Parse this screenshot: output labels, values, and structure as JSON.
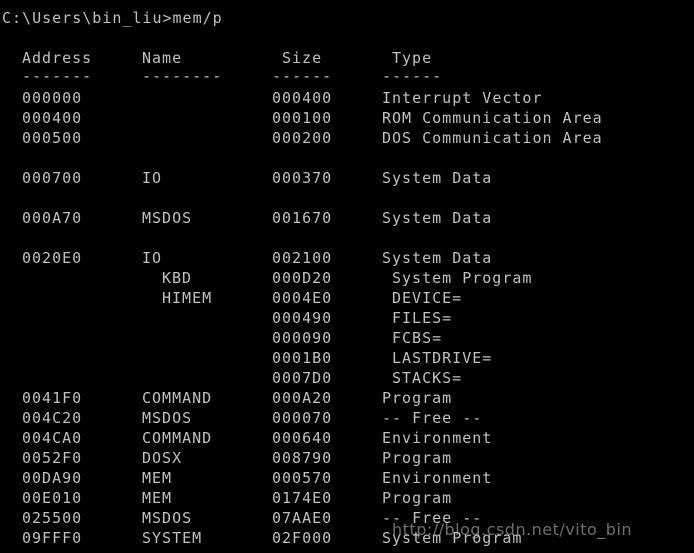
{
  "prompt": "C:\\Users\\bin_liu>mem/p",
  "headers": {
    "address": "Address",
    "name": "Name",
    "size": "Size",
    "type": "Type"
  },
  "underlines": {
    "address": "-------",
    "name": "--------",
    "size": "------",
    "type": "------"
  },
  "rows": [
    {
      "address": "000000",
      "name": "",
      "sub": "",
      "size": "000400",
      "type": "Interrupt Vector"
    },
    {
      "address": "000400",
      "name": "",
      "sub": "",
      "size": "000100",
      "type": "ROM Communication Area"
    },
    {
      "address": "000500",
      "name": "",
      "sub": "",
      "size": "000200",
      "type": "DOS Communication Area"
    },
    {
      "address": "000700",
      "name": "IO",
      "sub": "",
      "size": "000370",
      "type": "System Data"
    },
    {
      "address": "000A70",
      "name": "MSDOS",
      "sub": "",
      "size": "001670",
      "type": "System Data"
    },
    {
      "address": "0020E0",
      "name": "IO",
      "sub": "",
      "size": "002100",
      "type": "System Data"
    },
    {
      "address": "",
      "name": "",
      "sub": "KBD",
      "size": "000D20",
      "type": "",
      "subtype": "System Program"
    },
    {
      "address": "",
      "name": "",
      "sub": "HIMEM",
      "size": "0004E0",
      "type": "",
      "subtype": "DEVICE="
    },
    {
      "address": "",
      "name": "",
      "sub": "",
      "size": "000490",
      "type": "",
      "subtype": "FILES="
    },
    {
      "address": "",
      "name": "",
      "sub": "",
      "size": "000090",
      "type": "",
      "subtype": "FCBS="
    },
    {
      "address": "",
      "name": "",
      "sub": "",
      "size": "0001B0",
      "type": "",
      "subtype": "LASTDRIVE="
    },
    {
      "address": "",
      "name": "",
      "sub": "",
      "size": "0007D0",
      "type": "",
      "subtype": "STACKS="
    },
    {
      "address": "0041F0",
      "name": "COMMAND",
      "sub": "",
      "size": "000A20",
      "type": "Program"
    },
    {
      "address": "004C20",
      "name": "MSDOS",
      "sub": "",
      "size": "000070",
      "type": "-- Free --"
    },
    {
      "address": "004CA0",
      "name": "COMMAND",
      "sub": "",
      "size": "000640",
      "type": "Environment"
    },
    {
      "address": "0052F0",
      "name": "DOSX",
      "sub": "",
      "size": "008790",
      "type": "Program"
    },
    {
      "address": "00DA90",
      "name": "MEM",
      "sub": "",
      "size": "000570",
      "type": "Environment"
    },
    {
      "address": "00E010",
      "name": "MEM",
      "sub": "",
      "size": "0174E0",
      "type": "Program"
    },
    {
      "address": "025500",
      "name": "MSDOS",
      "sub": "",
      "size": "07AAE0",
      "type": "-- Free --"
    },
    {
      "address": "09FFF0",
      "name": "SYSTEM",
      "sub": "",
      "size": "02F000",
      "type": "System Program"
    }
  ],
  "watermark": "http://blog.csdn.net/vito_bin",
  "colors": {
    "background": "#000000",
    "text": "#c0c0c0"
  }
}
